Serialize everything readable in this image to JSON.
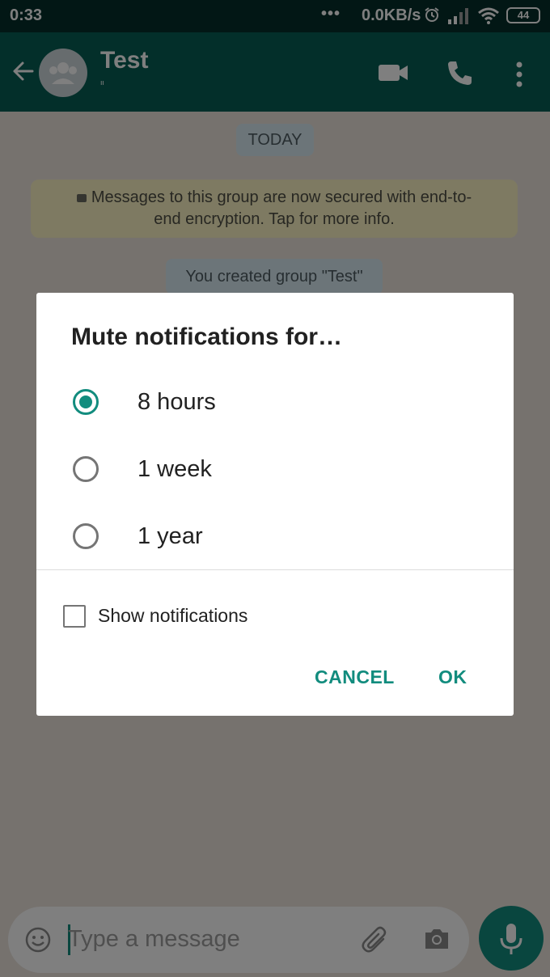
{
  "status_bar": {
    "time": "0:33",
    "dots": "•••",
    "network_speed": "0.0KB/s",
    "battery": "44"
  },
  "toolbar": {
    "title": "Test",
    "subtitle": "ᐦ"
  },
  "chat": {
    "date_chip": "TODAY",
    "encryption_notice_line1": "Messages to this group are now secured with end-to-",
    "encryption_notice_line2": "end encryption. Tap for more info.",
    "created_message": "You created group \"Test\""
  },
  "dialog": {
    "title": "Mute notifications for…",
    "options": [
      {
        "label": "8 hours",
        "selected": true
      },
      {
        "label": "1 week",
        "selected": false
      },
      {
        "label": "1 year",
        "selected": false
      }
    ],
    "show_notifications_label": "Show notifications",
    "show_notifications_checked": false,
    "cancel_label": "CANCEL",
    "ok_label": "OK"
  },
  "composer": {
    "placeholder": "Type a message"
  },
  "colors": {
    "accent": "#128c7e",
    "toolbar": "#075e54",
    "status_bar": "#052e2a"
  }
}
